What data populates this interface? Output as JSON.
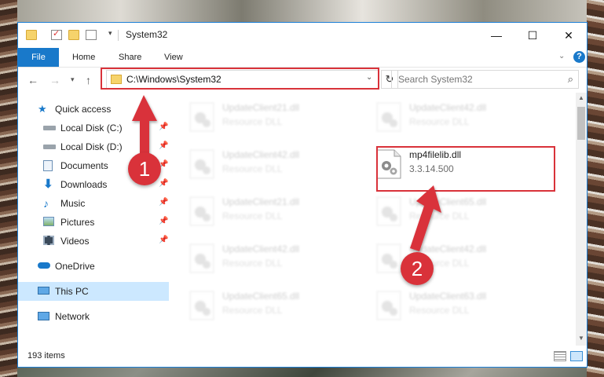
{
  "window": {
    "title": "System32",
    "accent": "#1979ca",
    "controls": {
      "minimize": "—",
      "maximize": "☐",
      "close": "✕"
    }
  },
  "ribbon": {
    "tabs": [
      {
        "label": "File",
        "active": true
      },
      {
        "label": "Home"
      },
      {
        "label": "Share"
      },
      {
        "label": "View"
      }
    ],
    "help": "?"
  },
  "nav": {
    "address": "C:\\Windows\\System32",
    "search_placeholder": "Search System32"
  },
  "sidebar": {
    "items": [
      {
        "label": "Quick access",
        "icon": "star-icon",
        "pinned": false
      },
      {
        "label": "Local Disk (C:)",
        "icon": "drive-icon",
        "pinned": true
      },
      {
        "label": "Local Disk (D:)",
        "icon": "drive-icon",
        "pinned": true
      },
      {
        "label": "Documents",
        "icon": "documents-icon",
        "pinned": true
      },
      {
        "label": "Downloads",
        "icon": "downloads-icon",
        "pinned": true
      },
      {
        "label": "Music",
        "icon": "music-icon",
        "pinned": true
      },
      {
        "label": "Pictures",
        "icon": "pictures-icon",
        "pinned": true
      },
      {
        "label": "Videos",
        "icon": "videos-icon",
        "pinned": true
      },
      {
        "label": "OneDrive",
        "icon": "onedrive-icon"
      },
      {
        "label": "This PC",
        "icon": "this-pc-icon",
        "selected": true
      },
      {
        "label": "Network",
        "icon": "network-icon"
      }
    ]
  },
  "files": [
    {
      "name": "UpdateClient21.dll",
      "desc": "Resource DLL"
    },
    {
      "name": "UpdateClient42.dll",
      "desc": "Resource DLL"
    },
    {
      "name": "UpdateClient42.dll",
      "desc": "Resource DLL"
    },
    {
      "name": "mp4filelib.dll",
      "desc": "3.3.14.500",
      "highlighted": true
    },
    {
      "name": "UpdateClient21.dll",
      "desc": "Resource DLL"
    },
    {
      "name": "UpdateClient65.dll",
      "desc": "Resource DLL"
    },
    {
      "name": "UpdateClient42.dll",
      "desc": "Resource DLL"
    },
    {
      "name": "UpdateClient42.dll",
      "desc": "Resource DLL"
    },
    {
      "name": "UpdateClient65.dll",
      "desc": "Resource DLL"
    },
    {
      "name": "UpdateClient63.dll",
      "desc": "Resource DLL"
    }
  ],
  "status": {
    "count": "193 items"
  },
  "annotations": {
    "marker1": "1",
    "marker2": "2",
    "color": "#d9323a"
  }
}
